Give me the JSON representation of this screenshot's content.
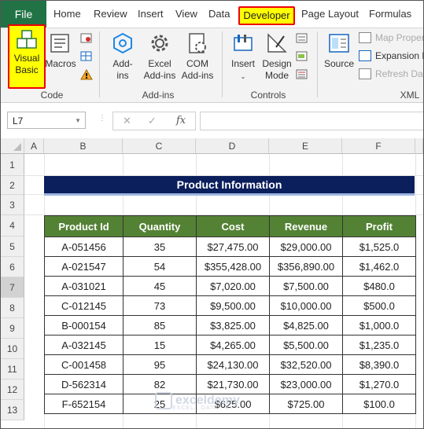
{
  "tabs": {
    "file": "File",
    "home": "Home",
    "review": "Review",
    "insert": "Insert",
    "view": "View",
    "data": "Data",
    "developer": "Developer",
    "page_layout": "Page Layout",
    "formulas": "Formulas"
  },
  "ribbon": {
    "code": {
      "label": "Code",
      "visual_basic": [
        "Visual",
        "Basic"
      ],
      "macros": "Macros"
    },
    "addins": {
      "label": "Add-ins",
      "addins": [
        "Add-",
        "ins"
      ],
      "excel_addins": [
        "Excel",
        "Add-ins"
      ],
      "com_addins": [
        "COM",
        "Add-ins"
      ]
    },
    "controls": {
      "label": "Controls",
      "insert": "Insert",
      "design_mode": [
        "Design",
        "Mode"
      ]
    },
    "xml": {
      "label": "XML",
      "source": "Source",
      "map_properties": "Map Proper",
      "expansion_packs": "Expansion P",
      "refresh_data": "Refresh Data"
    }
  },
  "formula_bar": {
    "name_box": "L7",
    "fx": "fx",
    "formula": ""
  },
  "columns": [
    "A",
    "B",
    "C",
    "D",
    "E",
    "F"
  ],
  "rows": [
    "1",
    "2",
    "3",
    "4",
    "5",
    "6",
    "7",
    "8",
    "9",
    "10",
    "11",
    "12",
    "13"
  ],
  "sheet_title": "Product Information",
  "table": {
    "headers": [
      "Product Id",
      "Quantity",
      "Cost",
      "Revenue",
      "Profit"
    ],
    "rows": [
      [
        "A-051456",
        "35",
        "$27,475.00",
        "$29,000.00",
        "$1,525.0"
      ],
      [
        "A-021547",
        "54",
        "$355,428.00",
        "$356,890.00",
        "$1,462.0"
      ],
      [
        "A-031021",
        "45",
        "$7,020.00",
        "$7,500.00",
        "$480.0"
      ],
      [
        "C-012145",
        "73",
        "$9,500.00",
        "$10,000.00",
        "$500.0"
      ],
      [
        "B-000154",
        "85",
        "$3,825.00",
        "$4,825.00",
        "$1,000.0"
      ],
      [
        "A-032145",
        "15",
        "$4,265.00",
        "$5,500.00",
        "$1,235.0"
      ],
      [
        "C-001458",
        "95",
        "$24,130.00",
        "$32,520.00",
        "$8,390.0"
      ],
      [
        "D-562314",
        "82",
        "$21,730.00",
        "$23,000.00",
        "$1,270.0"
      ],
      [
        "F-652154",
        "25",
        "$625.00",
        "$725.00",
        "$100.0"
      ]
    ]
  },
  "watermark": {
    "brand": "exceldemy",
    "tagline": "EXCEL · DATA · BI"
  },
  "colors": {
    "file_tab": "#217346",
    "title_fill": "#0b1f5c",
    "header_fill": "#548235",
    "highlight": "#ffff00",
    "highlight_border": "#e00000"
  }
}
